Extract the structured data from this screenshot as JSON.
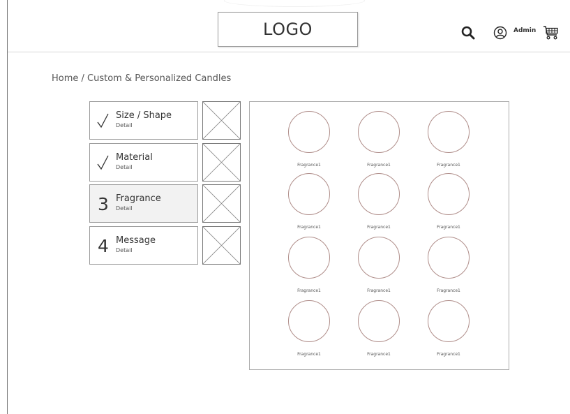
{
  "header": {
    "logo_text": "LOGO",
    "user_label": "Admin",
    "icons": {
      "search": "search-icon",
      "user": "user-icon",
      "cart": "cart-icon"
    }
  },
  "breadcrumb": {
    "text": "Home / Custom & Personalized Candles"
  },
  "steps": [
    {
      "mark": "✓",
      "title": "Size / Shape",
      "detail": "Detail",
      "state": "completed"
    },
    {
      "mark": "✓",
      "title": "Material",
      "detail": "Detail",
      "state": "completed"
    },
    {
      "mark": "3",
      "title": "Fragrance",
      "detail": "Detail",
      "state": "active"
    },
    {
      "mark": "4",
      "title": "Message",
      "detail": "Detail",
      "state": "pending"
    }
  ],
  "fragrances": [
    {
      "label": "Fragrance1"
    },
    {
      "label": "Fragrance1"
    },
    {
      "label": "Fragrance1"
    },
    {
      "label": "Fragrance1"
    },
    {
      "label": "Fragrance1"
    },
    {
      "label": "Fragrance1"
    },
    {
      "label": "Fragrance1"
    },
    {
      "label": "Fragrance1"
    },
    {
      "label": "Fragrance1"
    },
    {
      "label": "Fragrance1"
    },
    {
      "label": "Fragrance1"
    },
    {
      "label": "Fragrance1"
    }
  ],
  "colors": {
    "border": "#9a9a9a",
    "circle_border": "#b08e8a",
    "active_step_bg": "#f2f2f2"
  }
}
